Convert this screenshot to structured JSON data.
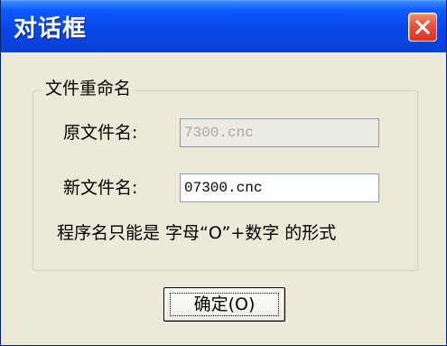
{
  "window": {
    "title": "对话框",
    "close_icon": "close-icon"
  },
  "group": {
    "title": "文件重命名"
  },
  "fields": {
    "original_label": "原文件名:",
    "original_value": "7300.cnc",
    "new_label": "新文件名:",
    "new_value": "07300.cnc"
  },
  "hint": "程序名只能是 字母“O”+数字 的形式",
  "buttons": {
    "ok": "确定(O)"
  },
  "colors": {
    "title_bar": "#0846e7",
    "close_button": "#e8533d",
    "dialog_background": "#ece9d8",
    "disabled_field_background": "#ebebe4",
    "disabled_text": "#aca899"
  }
}
